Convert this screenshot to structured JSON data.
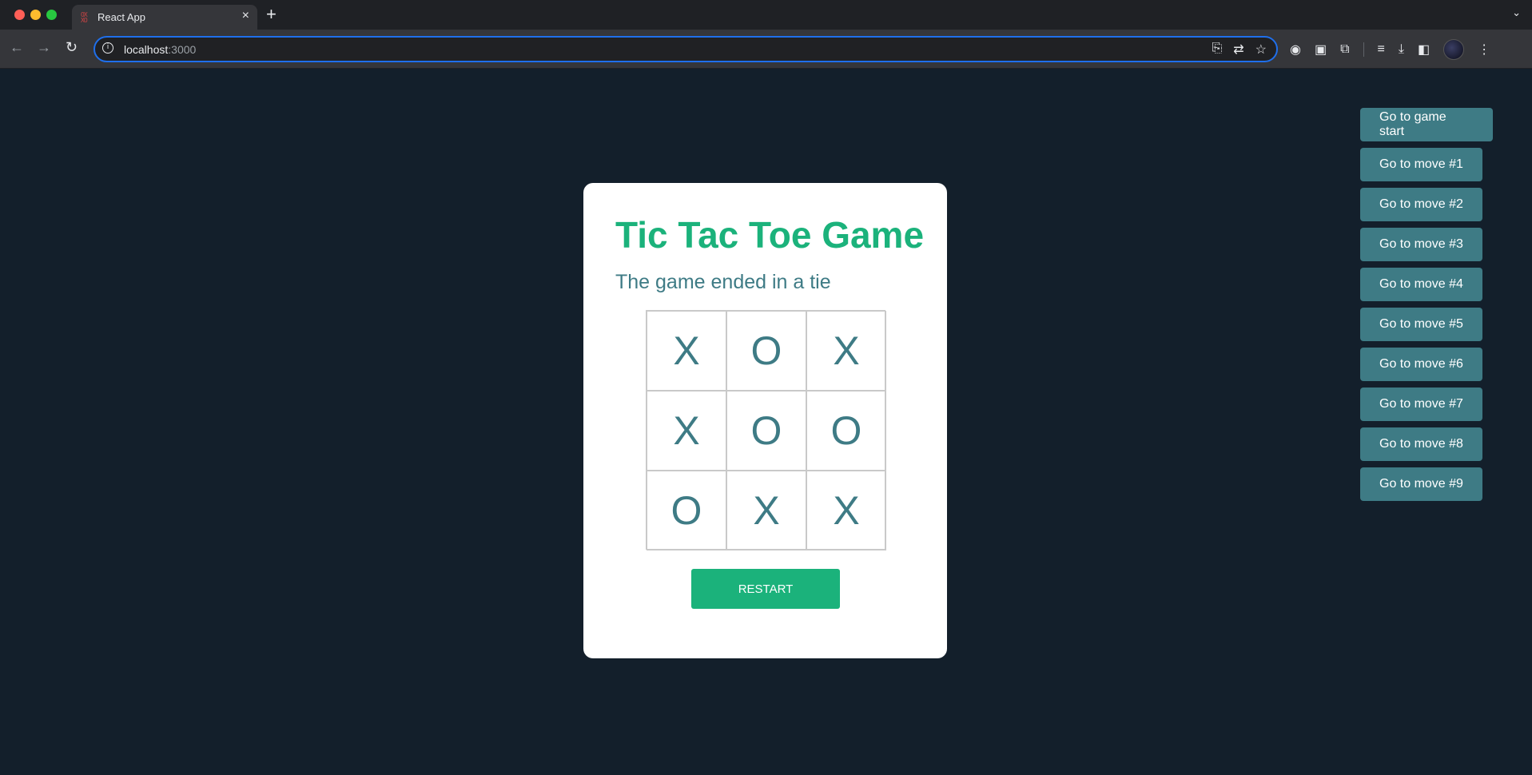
{
  "browser": {
    "tab_title": "React App",
    "url_host": "localhost",
    "url_port": ":3000"
  },
  "game": {
    "title": "Tic Tac Toe Game",
    "status": "The game ended in a tie",
    "board": [
      "X",
      "O",
      "X",
      "X",
      "O",
      "O",
      "O",
      "X",
      "X"
    ],
    "restart_label": "RESTART",
    "history": [
      "Go to game start",
      "Go to move #1",
      "Go to move #2",
      "Go to move #3",
      "Go to move #4",
      "Go to move #5",
      "Go to move #6",
      "Go to move #7",
      "Go to move #8",
      "Go to move #9"
    ]
  },
  "colors": {
    "page_bg": "#131f2b",
    "accent_green": "#1bb27b",
    "teal": "#3e7b85"
  }
}
